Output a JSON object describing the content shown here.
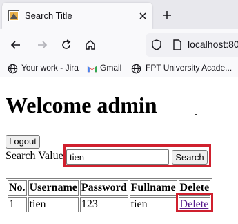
{
  "browser": {
    "tab_title": "Search Title",
    "url": "localhost:80",
    "bookmarks": [
      {
        "label": "Your work - Jira",
        "icon": "globe-icon"
      },
      {
        "label": "Gmail",
        "icon": "gmail-icon"
      },
      {
        "label": "FPT University Acade...",
        "icon": "globe-icon"
      }
    ]
  },
  "page": {
    "heading": "Welcome admin",
    "logout_label": "Logout",
    "search_label": "Search Value",
    "search_value": "tien",
    "search_button_label": "Search"
  },
  "table": {
    "headers": [
      "No.",
      "Username",
      "Password",
      "Fullname",
      "Delete"
    ],
    "rows": [
      {
        "no": "1",
        "username": "tien",
        "password": "123",
        "fullname": "tien",
        "delete": "Delete"
      }
    ]
  },
  "colors": {
    "highlight_border": "#d0202e",
    "visited_link": "#551a8b"
  }
}
